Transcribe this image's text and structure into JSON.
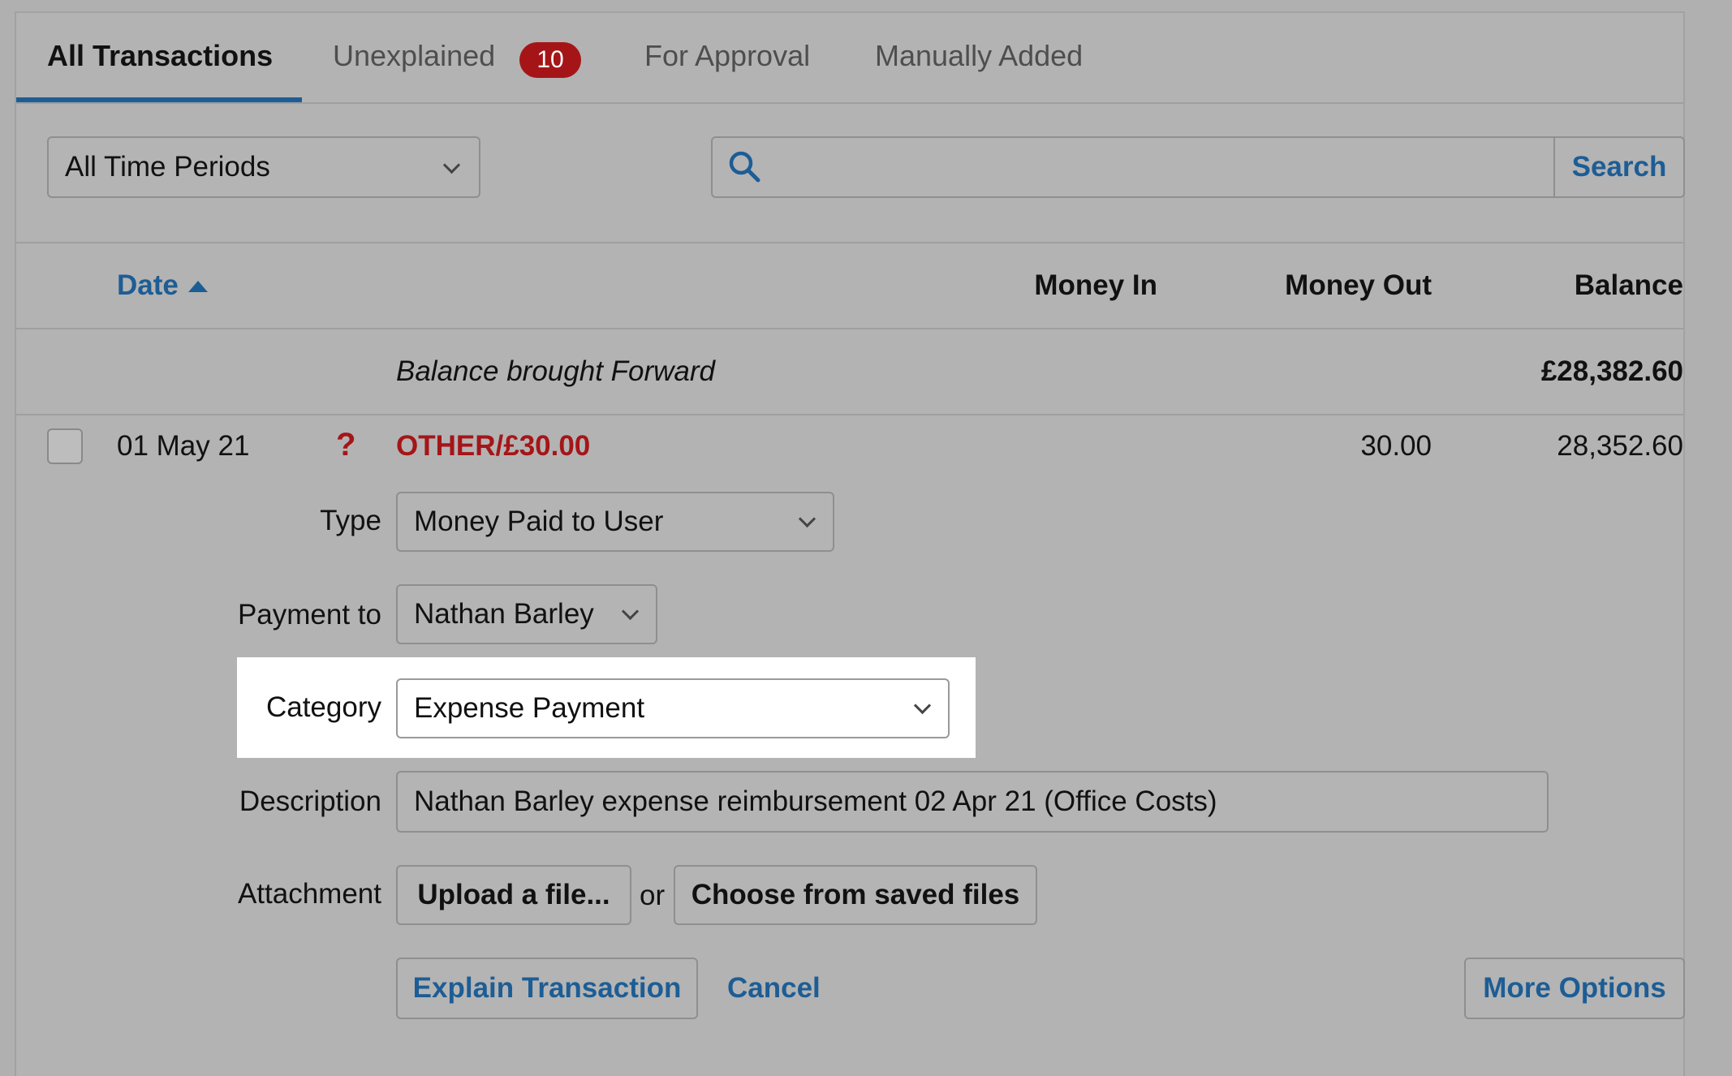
{
  "tabs": {
    "all": "All Transactions",
    "unexplained": "Unexplained",
    "unexplained_count": "10",
    "approval": "For Approval",
    "manual": "Manually Added"
  },
  "filters": {
    "period": "All Time Periods",
    "search_value": "",
    "search_button": "Search"
  },
  "columns": {
    "date": "Date",
    "money_in": "Money In",
    "money_out": "Money Out",
    "balance": "Balance"
  },
  "balance_forward": {
    "label": "Balance brought Forward",
    "amount": "£28,382.60"
  },
  "transaction": {
    "date": "01 May 21",
    "status_symbol": "?",
    "name": "OTHER/£30.00",
    "money_out": "30.00",
    "balance": "28,352.60",
    "fields": {
      "type_label": "Type",
      "type_value": "Money Paid to User",
      "payment_to_label": "Payment to",
      "payment_to_value": "Nathan Barley",
      "category_label": "Category",
      "category_value": "Expense Payment",
      "description_label": "Description",
      "description_value": "Nathan Barley expense reimbursement 02 Apr 21 (Office Costs)",
      "attachment_label": "Attachment",
      "upload_button": "Upload a file...",
      "or_text": "or",
      "choose_button": "Choose from saved files"
    },
    "actions": {
      "explain": "Explain Transaction",
      "cancel": "Cancel",
      "more": "More Options"
    }
  },
  "colors": {
    "accent": "#1d5d95",
    "danger": "#a51518",
    "background": "#b3b3b3"
  },
  "icons": {
    "search": "search-icon",
    "sort": "sort-ascending-icon",
    "dropdown": "chevron-down-icon"
  }
}
